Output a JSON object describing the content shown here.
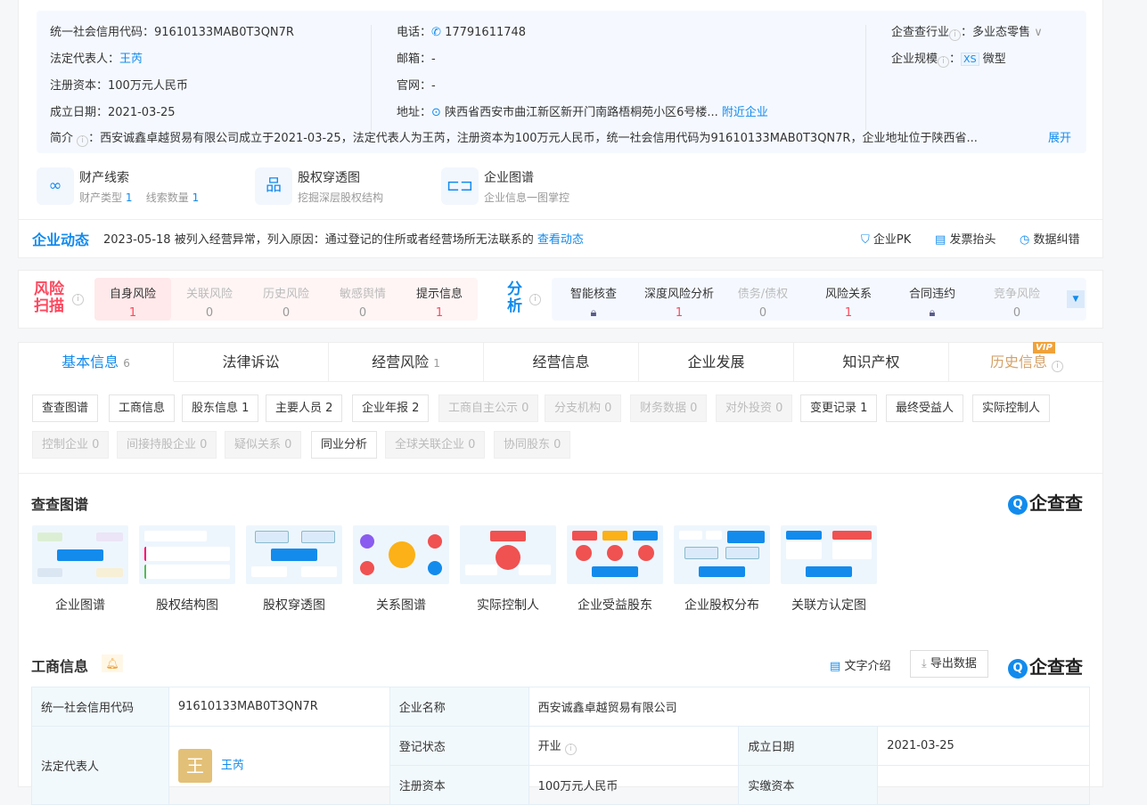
{
  "info": {
    "credit_code_label": "统一社会信用代码：",
    "credit_code": "91610133MAB0T3QN7R",
    "legal_rep_label": "法定代表人：",
    "legal_rep": "王芮",
    "capital_label": "注册资本：",
    "capital": "100万元人民币",
    "founded_label": "成立日期：",
    "founded": "2021-03-25",
    "phone_label": "电话：",
    "phone": "17791611748",
    "email_label": "邮箱：",
    "email": "-",
    "website_label": "官网：",
    "website": "-",
    "address_label": "地址：",
    "address": "陕西省西安市曲江新区新开门南路梧桐苑小区6号楼...",
    "nearby": "附近企业",
    "industry_label": "企查查行业",
    "industry": "多业态零售",
    "scale_label": "企业规模",
    "scale_badge": "XS",
    "scale": "微型",
    "intro_label": "简介",
    "intro": "：西安诚鑫卓越贸易有限公司成立于2021-03-25，法定代表人为王芮，注册资本为100万元人民币，统一社会信用代码为91610133MAB0T3QN7R，企业地址位于陕西省...",
    "expand": "展开"
  },
  "quick": [
    {
      "title": "财产线索",
      "sub1": "财产类型",
      "n1": "1",
      "sub2": "线索数量",
      "n2": "1"
    },
    {
      "title": "股权穿透图",
      "sub": "挖掘深层股权结构"
    },
    {
      "title": "企业图谱",
      "sub": "企业信息一图掌控"
    }
  ],
  "dynamic": {
    "title": "企业动态",
    "date": "2023-05-18",
    "text": "被列入经营异常，列入原因：通过登记的住所或者经营场所无法联系的",
    "link": "查看动态",
    "actions": [
      "企业PK",
      "发票抬头",
      "数据纠错"
    ]
  },
  "risk": {
    "title1": "风险",
    "title2": "扫描",
    "items": [
      {
        "label": "自身风险",
        "v": "1"
      },
      {
        "label": "关联风险",
        "v": "0"
      },
      {
        "label": "历史风险",
        "v": "0"
      },
      {
        "label": "敏感舆情",
        "v": "0"
      },
      {
        "label": "提示信息",
        "v": "1"
      }
    ]
  },
  "analysis": {
    "title1": "分",
    "title2": "析",
    "items": [
      {
        "label": "智能核查",
        "v": ""
      },
      {
        "label": "深度风险分析",
        "v": "1"
      },
      {
        "label": "债务/债权",
        "v": "0"
      },
      {
        "label": "风险关系",
        "v": "1"
      },
      {
        "label": "合同违约",
        "v": ""
      },
      {
        "label": "竞争风险",
        "v": "0"
      }
    ]
  },
  "tabs": [
    {
      "label": "基本信息",
      "count": "6"
    },
    {
      "label": "法律诉讼",
      "count": ""
    },
    {
      "label": "经营风险",
      "count": "1"
    },
    {
      "label": "经营信息",
      "count": ""
    },
    {
      "label": "企业发展",
      "count": ""
    },
    {
      "label": "知识产权",
      "count": ""
    },
    {
      "label": "历史信息",
      "count": "",
      "badge": "VIP"
    }
  ],
  "tags": [
    "查查图谱",
    "工商信息",
    "股东信息 1",
    "主要人员 2",
    "企业年报 2",
    "工商自主公示 0",
    "分支机构 0",
    "财务数据 0",
    "对外投资 0",
    "变更记录 1",
    "最终受益人",
    "实际控制人",
    "控制企业 0",
    "间接持股企业 0",
    "疑似关系 0",
    "同业分析",
    "全球关联企业 0",
    "协同股东 0"
  ],
  "graphs": {
    "title": "查查图谱",
    "logo": "企查查",
    "items": [
      "企业图谱",
      "股权结构图",
      "股权穿透图",
      "关系图谱",
      "实际控制人",
      "企业受益股东",
      "企业股权分布",
      "关联方认定图"
    ]
  },
  "biz": {
    "title": "工商信息",
    "text_intro": "文字介绍",
    "export": "导出数据",
    "logo": "企查查",
    "rows": {
      "credit_label": "统一社会信用代码",
      "credit": "91610133MAB0T3QN7R",
      "name_label": "企业名称",
      "name": "西安诚鑫卓越贸易有限公司",
      "rep_label": "法定代表人",
      "rep_avatar": "王",
      "rep": "王芮",
      "status_label": "登记状态",
      "status": "开业",
      "date_label": "成立日期",
      "date": "2021-03-25",
      "capital_label": "注册资本",
      "capital": "100万元人民币",
      "paid_label": "实缴资本"
    }
  }
}
